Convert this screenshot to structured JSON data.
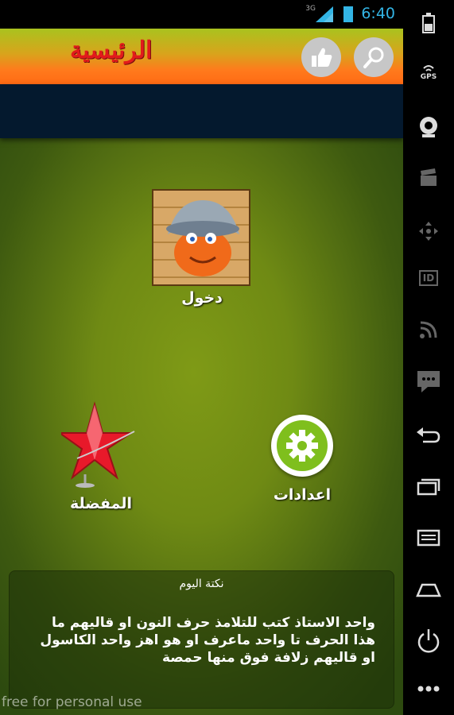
{
  "status_bar": {
    "network": "3G",
    "time": "6:40"
  },
  "header": {
    "title": "الرئيسية",
    "like_icon": "thumbs-up-icon",
    "search_icon": "search-icon"
  },
  "tiles": {
    "login": {
      "label": "دخول",
      "icon": "pumpkin-hat-image"
    },
    "favorites": {
      "label": "المفضلة",
      "icon": "star-trophy-icon"
    },
    "settings": {
      "label": "اعدادات",
      "icon": "gear-icon"
    }
  },
  "joke": {
    "title": "نكتة اليوم",
    "text": "واحد الاستاذ كتب للتلامذ حرف النون او قاليهم ما هذا الحرف تا واحد ماعرف او هو اهز واحد الكاسول او قاليهم زلافة فوق منها حمصة"
  },
  "watermark": "free for personal use",
  "nav_bar": {
    "gps_label": "GPS",
    "id_label": "ID"
  },
  "colors": {
    "accent": "#33b5e5",
    "header_orange": "#ff7a1c",
    "title_red": "#e21b1b",
    "dark_band": "#04192e"
  }
}
